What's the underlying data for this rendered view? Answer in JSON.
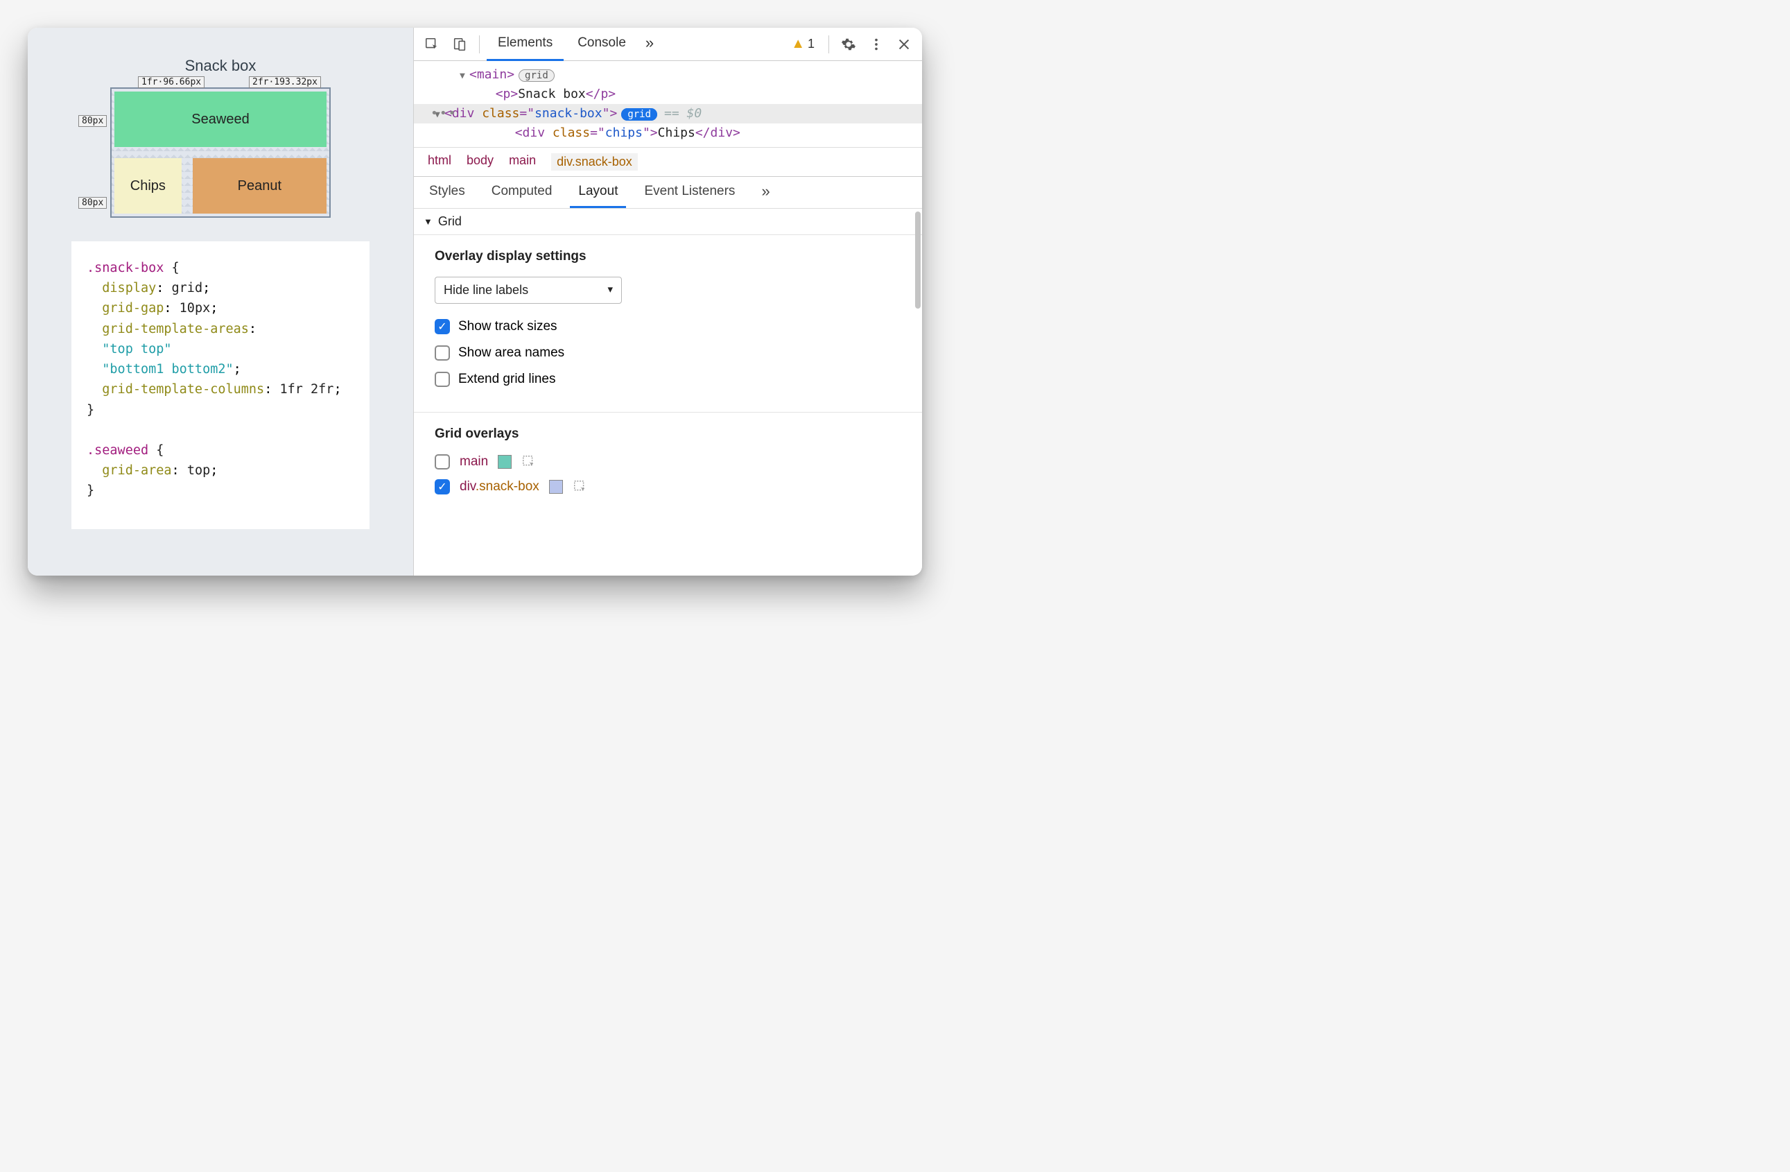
{
  "page": {
    "title": "Snack box",
    "grid": {
      "col_labels": [
        "1fr·96.66px",
        "2fr·193.32px"
      ],
      "row_labels": [
        "80px",
        "80px"
      ],
      "cells": {
        "seaweed": "Seaweed",
        "chips": "Chips",
        "peanut": "Peanut"
      }
    },
    "css": {
      "l0": ".snack-box {",
      "l1": "  display: grid;",
      "l1_prop": "display",
      "l1_val": "grid",
      "l2_prop": "grid-gap",
      "l2_val": "10px",
      "l3_prop": "grid-template-areas",
      "l4_str": "\"top top\"",
      "l5_str": "\"bottom1 bottom2\"",
      "l6_prop": "grid-template-columns",
      "l6_val": "1fr 2fr",
      "sel2": ".seaweed {",
      "l7_prop": "grid-area",
      "l7_val": "top"
    }
  },
  "devtools": {
    "tabs": {
      "elements": "Elements",
      "console": "Console"
    },
    "more_glyph": "»",
    "warning_count": "1",
    "dom": {
      "main_open": "main",
      "grid_badge": "grid",
      "p_line_open": "p",
      "p_text": "Snack box",
      "p_line_close": "/p",
      "div_open": "div",
      "class_attr": "class",
      "snack_val": "snack-box",
      "dollar": "== $0",
      "chips_val": "chips",
      "chips_text": "Chips"
    },
    "crumbs": [
      "html",
      "body",
      "main",
      "div.snack-box"
    ],
    "subtabs": {
      "styles": "Styles",
      "computed": "Computed",
      "layout": "Layout",
      "listeners": "Event Listeners"
    },
    "layout": {
      "grid_header": "Grid",
      "overlay_heading": "Overlay display settings",
      "dropdown": "Hide line labels",
      "opt_track": "Show track sizes",
      "opt_area": "Show area names",
      "opt_extend": "Extend grid lines",
      "overlays_heading": "Grid overlays",
      "ov_main": "main",
      "ov_div": "div",
      "ov_div_cls": ".snack-box"
    }
  }
}
